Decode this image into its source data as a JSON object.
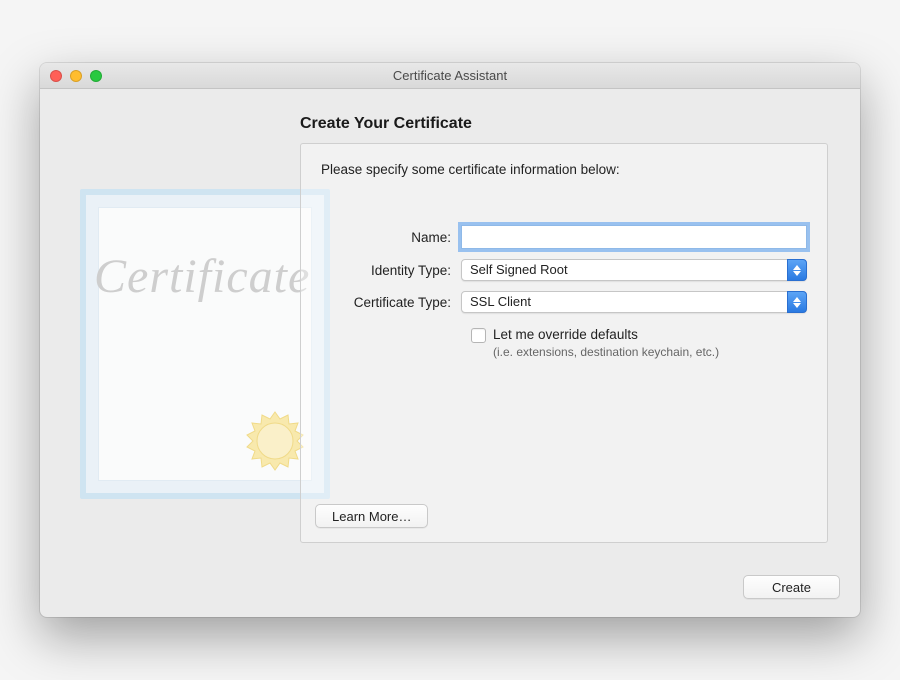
{
  "window": {
    "title": "Certificate Assistant"
  },
  "heading": "Create Your Certificate",
  "panel": {
    "instruction": "Please specify some certificate information below:",
    "fields": {
      "name": {
        "label": "Name:",
        "value": ""
      },
      "identity_type": {
        "label": "Identity Type:",
        "value": "Self Signed Root"
      },
      "certificate_type": {
        "label": "Certificate Type:",
        "value": "SSL Client"
      }
    },
    "override": {
      "label": "Let me override defaults",
      "sublabel": "(i.e. extensions, destination keychain, etc.)",
      "checked": false
    },
    "learn_more": "Learn More…"
  },
  "footer": {
    "create": "Create"
  },
  "decor": {
    "script_text": "Certificate"
  }
}
